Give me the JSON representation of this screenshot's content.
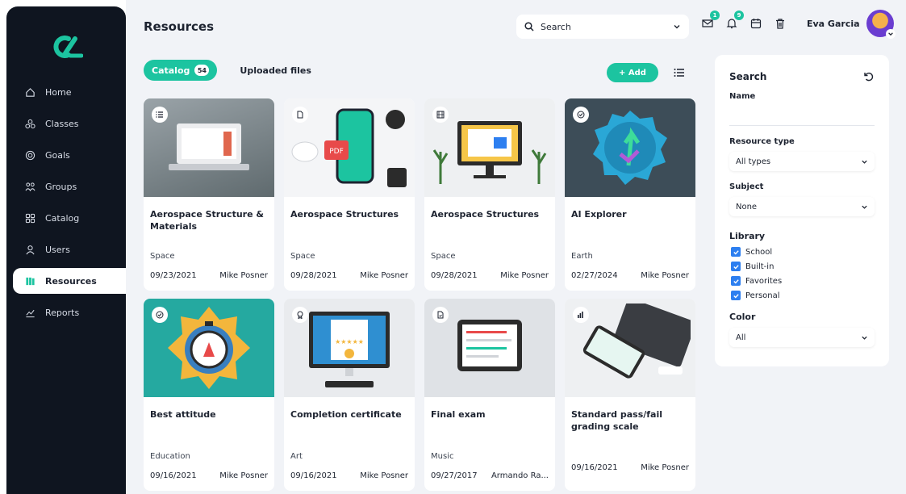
{
  "sidebar": {
    "items": [
      {
        "label": "Home",
        "icon": "home-icon"
      },
      {
        "label": "Classes",
        "icon": "classes-icon"
      },
      {
        "label": "Goals",
        "icon": "goals-icon"
      },
      {
        "label": "Groups",
        "icon": "groups-icon"
      },
      {
        "label": "Catalog",
        "icon": "catalog-icon"
      },
      {
        "label": "Users",
        "icon": "users-icon"
      },
      {
        "label": "Resources",
        "icon": "resources-icon",
        "active": true
      },
      {
        "label": "Reports",
        "icon": "reports-icon"
      }
    ]
  },
  "header": {
    "title": "Resources",
    "search_label": "Search",
    "user_name": "Eva Garcia",
    "badges": {
      "messages": "1",
      "notifications": "9"
    }
  },
  "tabs": [
    {
      "label": "Catalog",
      "count": "54",
      "active": true
    },
    {
      "label": "Uploaded files"
    }
  ],
  "add_label": "+ Add",
  "cards": [
    {
      "title": "Aerospace Structure & Materials",
      "subject": "Space",
      "date": "09/23/2021",
      "author": "Mike Posner",
      "type_icon": "list-icon"
    },
    {
      "title": "Aerospace Structures",
      "subject": "Space",
      "date": "09/28/2021",
      "author": "Mike Posner",
      "type_icon": "pdf-icon"
    },
    {
      "title": "Aerospace Structures",
      "subject": "Space",
      "date": "09/28/2021",
      "author": "Mike Posner",
      "type_icon": "film-icon"
    },
    {
      "title": "AI Explorer",
      "subject": "Earth",
      "date": "02/27/2024",
      "author": "Mike Posner",
      "type_icon": "badge-icon"
    },
    {
      "title": "Best attitude",
      "subject": "Education",
      "date": "09/16/2021",
      "author": "Mike Posner",
      "type_icon": "badge-icon"
    },
    {
      "title": "Completion certificate",
      "subject": "Art",
      "date": "09/16/2021",
      "author": "Mike Posner",
      "type_icon": "certificate-icon"
    },
    {
      "title": "Final exam",
      "subject": "Music",
      "date": "09/27/2017",
      "author": "Armando Ra...",
      "type_icon": "exam-icon"
    },
    {
      "title": "Standard pass/fail grading scale",
      "subject": "",
      "date": "09/16/2021",
      "author": "Mike Posner",
      "type_icon": "chart-icon"
    }
  ],
  "filters": {
    "title": "Search",
    "name_label": "Name",
    "name_value": "",
    "resource_type_label": "Resource type",
    "resource_type_value": "All types",
    "subject_label": "Subject",
    "subject_value": "None",
    "library_label": "Library",
    "library_options": [
      {
        "label": "School",
        "checked": true
      },
      {
        "label": "Built-in",
        "checked": true
      },
      {
        "label": "Favorites",
        "checked": true
      },
      {
        "label": "Personal",
        "checked": true
      }
    ],
    "color_label": "Color",
    "color_value": "All"
  },
  "colors": {
    "accent": "#1cc4a0",
    "sidebar": "#0f1520",
    "checkbox": "#2d7ff0"
  }
}
